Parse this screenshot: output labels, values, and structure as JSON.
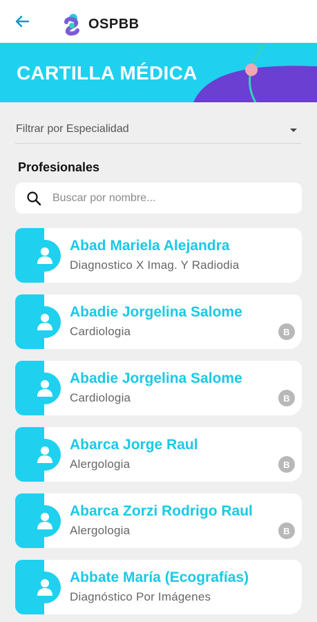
{
  "header": {
    "brand": "OSPBB"
  },
  "banner": {
    "title": "CARTILLA MÉDICA"
  },
  "filter": {
    "label": "Filtrar por Especialidad"
  },
  "section": {
    "title": "Profesionales"
  },
  "search": {
    "placeholder": "Buscar por nombre..."
  },
  "colors": {
    "accent": "#1fd1ee",
    "accent_text": "#19c9e6",
    "purple": "#6a3fd1",
    "banner_dot": "#f0a6b5"
  },
  "professionals": [
    {
      "name": "Abad Mariela Alejandra",
      "specialty": "Diagnostico X Imag. Y Radiodia",
      "badge": ""
    },
    {
      "name": "Abadie Jorgelina Salome",
      "specialty": "Cardiologia",
      "badge": "B"
    },
    {
      "name": "Abadie Jorgelina Salome",
      "specialty": "Cardiologia",
      "badge": "B"
    },
    {
      "name": "Abarca Jorge Raul",
      "specialty": "Alergologia",
      "badge": "B"
    },
    {
      "name": "Abarca Zorzi Rodrigo Raul",
      "specialty": "Alergologia",
      "badge": "B"
    },
    {
      "name": "Abbate María (Ecografías)",
      "specialty": "Diagnóstico Por Imágenes",
      "badge": ""
    }
  ]
}
